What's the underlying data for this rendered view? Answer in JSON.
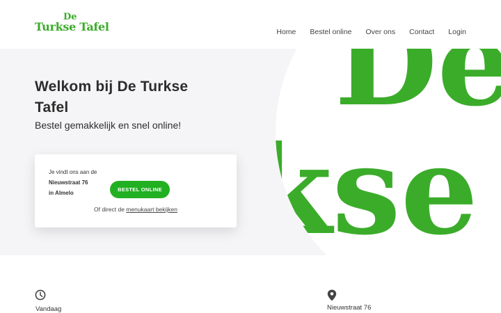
{
  "brand": {
    "logo_small": "De",
    "logo_name": "Turkse Tafel",
    "color": "#3bac2a"
  },
  "nav": {
    "items": [
      "Home",
      "Bestel online",
      "Over ons",
      "Contact",
      "Login"
    ]
  },
  "hero": {
    "title": "Welkom bij De Turkse Tafel",
    "subtitle": "Bestel gemakkelijk en snel online!",
    "art_text_top": "De",
    "art_text_bottom": "kse"
  },
  "card": {
    "intro": "Je vindt ons aan de",
    "street": "Nieuwstraat 76",
    "city": "in Almelo",
    "order_button": "BESTEL ONLINE",
    "footer_prefix": "Of direct de",
    "footer_link": "menukaart bekijken"
  },
  "info": {
    "today_label": "Vandaag",
    "address": "Nieuwstraat 76"
  },
  "colors": {
    "accent": "#21b021",
    "hero_bg": "#f5f5f7"
  },
  "icons": {
    "hours": "clock-icon",
    "location": "map-pin-icon"
  }
}
